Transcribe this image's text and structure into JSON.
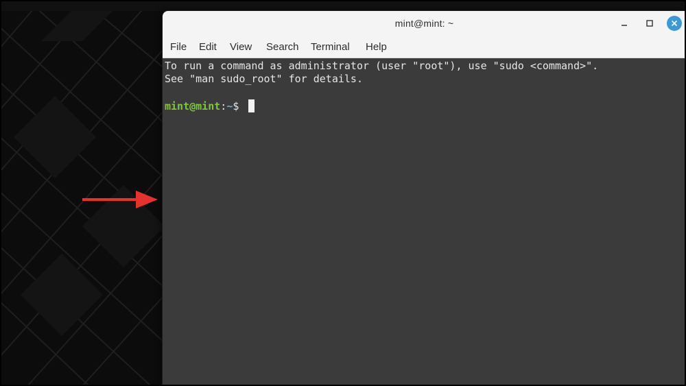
{
  "window": {
    "title": "mint@mint: ~"
  },
  "menubar": {
    "items": [
      {
        "label": "File"
      },
      {
        "label": "Edit"
      },
      {
        "label": "View"
      },
      {
        "label": "Search"
      },
      {
        "label": "Terminal"
      },
      {
        "label": "Help"
      }
    ]
  },
  "terminal": {
    "lines": [
      "To run a command as administrator (user \"root\"), use \"sudo <command>\".",
      "See \"man sudo_root\" for details."
    ],
    "prompt": {
      "user_host": "mint@mint",
      "separator": ":",
      "path": "~",
      "symbol": "$"
    }
  },
  "annotation": {
    "arrow_color": "#e5322d"
  },
  "colors": {
    "terminal_bg": "#3b3b3b",
    "prompt_user": "#7ec83a",
    "close_button": "#3a9ad9"
  },
  "icons": {
    "minimize": "minimize-icon",
    "maximize": "maximize-icon",
    "close": "close-icon"
  }
}
